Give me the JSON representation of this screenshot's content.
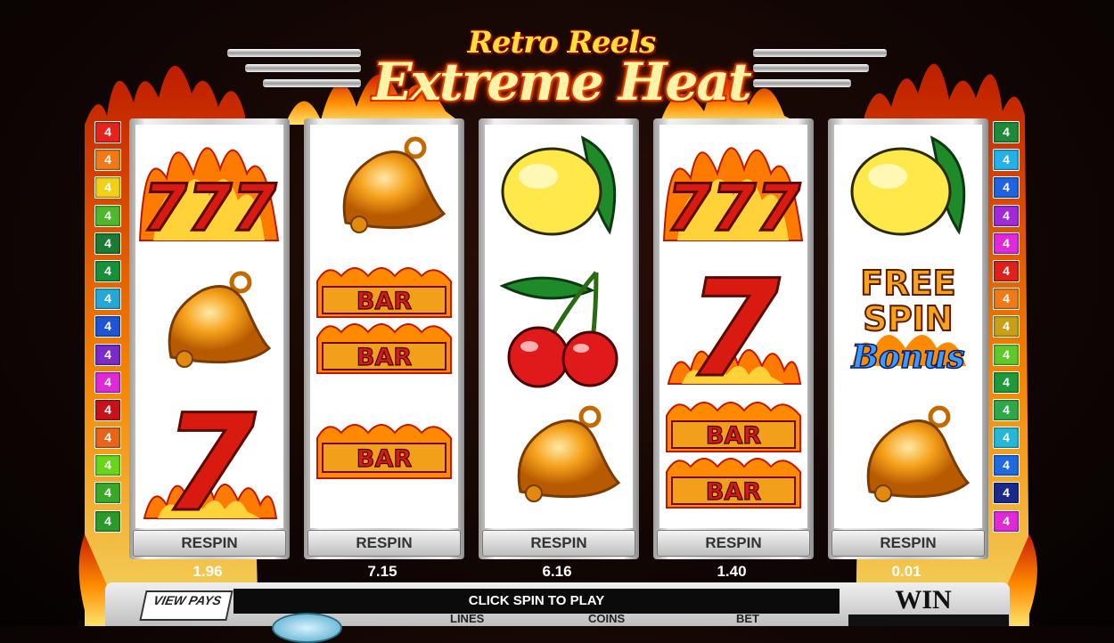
{
  "title": {
    "line1": "Retro Reels",
    "line2": "Extreme Heat"
  },
  "colors": {
    "background": "#120604",
    "reel_bg": "#ffffff",
    "flame_outer": "#ff4a00",
    "flame_inner": "#ffd23a"
  },
  "line_markers": {
    "left": [
      {
        "label": "4",
        "color": "#e8231b"
      },
      {
        "label": "4",
        "color": "#f07a18"
      },
      {
        "label": "4",
        "color": "#f3d018"
      },
      {
        "label": "4",
        "color": "#4fb82a"
      },
      {
        "label": "4",
        "color": "#1b7a33"
      },
      {
        "label": "4",
        "color": "#188f3a"
      },
      {
        "label": "4",
        "color": "#25a8d6"
      },
      {
        "label": "4",
        "color": "#1f54d6"
      },
      {
        "label": "4",
        "color": "#7a2bc8"
      },
      {
        "label": "4",
        "color": "#e02ad8"
      },
      {
        "label": "4",
        "color": "#c8121b"
      },
      {
        "label": "4",
        "color": "#e8641b"
      },
      {
        "label": "4",
        "color": "#68d61b"
      },
      {
        "label": "4",
        "color": "#3aa82a"
      },
      {
        "label": "4",
        "color": "#2a9a2a"
      }
    ],
    "right": [
      {
        "label": "4",
        "color": "#1f8a3a"
      },
      {
        "label": "4",
        "color": "#25b0e6"
      },
      {
        "label": "4",
        "color": "#1f63e0"
      },
      {
        "label": "4",
        "color": "#a12ad6"
      },
      {
        "label": "4",
        "color": "#e02ad8"
      },
      {
        "label": "4",
        "color": "#e0201b"
      },
      {
        "label": "4",
        "color": "#f07a18"
      },
      {
        "label": "4",
        "color": "#c8a018"
      },
      {
        "label": "4",
        "color": "#5fc82a"
      },
      {
        "label": "4",
        "color": "#1f9a3a"
      },
      {
        "label": "4",
        "color": "#2fa84a"
      },
      {
        "label": "4",
        "color": "#25b8d6"
      },
      {
        "label": "4",
        "color": "#1f6ae0"
      },
      {
        "label": "4",
        "color": "#1b2a8a"
      },
      {
        "label": "4",
        "color": "#e02ad8"
      }
    ]
  },
  "reels": [
    {
      "symbols": [
        "triple-seven-icon",
        "bell-icon",
        "seven-icon"
      ],
      "respin_label": "RESPIN",
      "value": "1.96"
    },
    {
      "symbols": [
        "bell-icon",
        "double-bar-icon",
        "single-bar-icon"
      ],
      "respin_label": "RESPIN",
      "value": "7.15"
    },
    {
      "symbols": [
        "lemon-icon",
        "cherry-icon",
        "bell-icon"
      ],
      "respin_label": "RESPIN",
      "value": "6.16"
    },
    {
      "symbols": [
        "triple-seven-icon",
        "seven-icon",
        "double-bar-icon"
      ],
      "respin_label": "RESPIN",
      "value": "1.40"
    },
    {
      "symbols": [
        "lemon-icon",
        "free-spin-bonus-icon",
        "bell-icon"
      ],
      "respin_label": "RESPIN",
      "value": "0.01"
    }
  ],
  "symbol_text": {
    "bar": "BAR",
    "seven": "7",
    "triple_seven": "777",
    "free": "FREE",
    "spin": "SPIN",
    "bonus": "Bonus"
  },
  "bottom": {
    "view_pays": "VIEW PAYS",
    "message": "CLICK SPIN TO PLAY",
    "lines_label": "LINES",
    "coins_label": "COINS",
    "bet_label": "BET",
    "win_label": "WIN"
  }
}
